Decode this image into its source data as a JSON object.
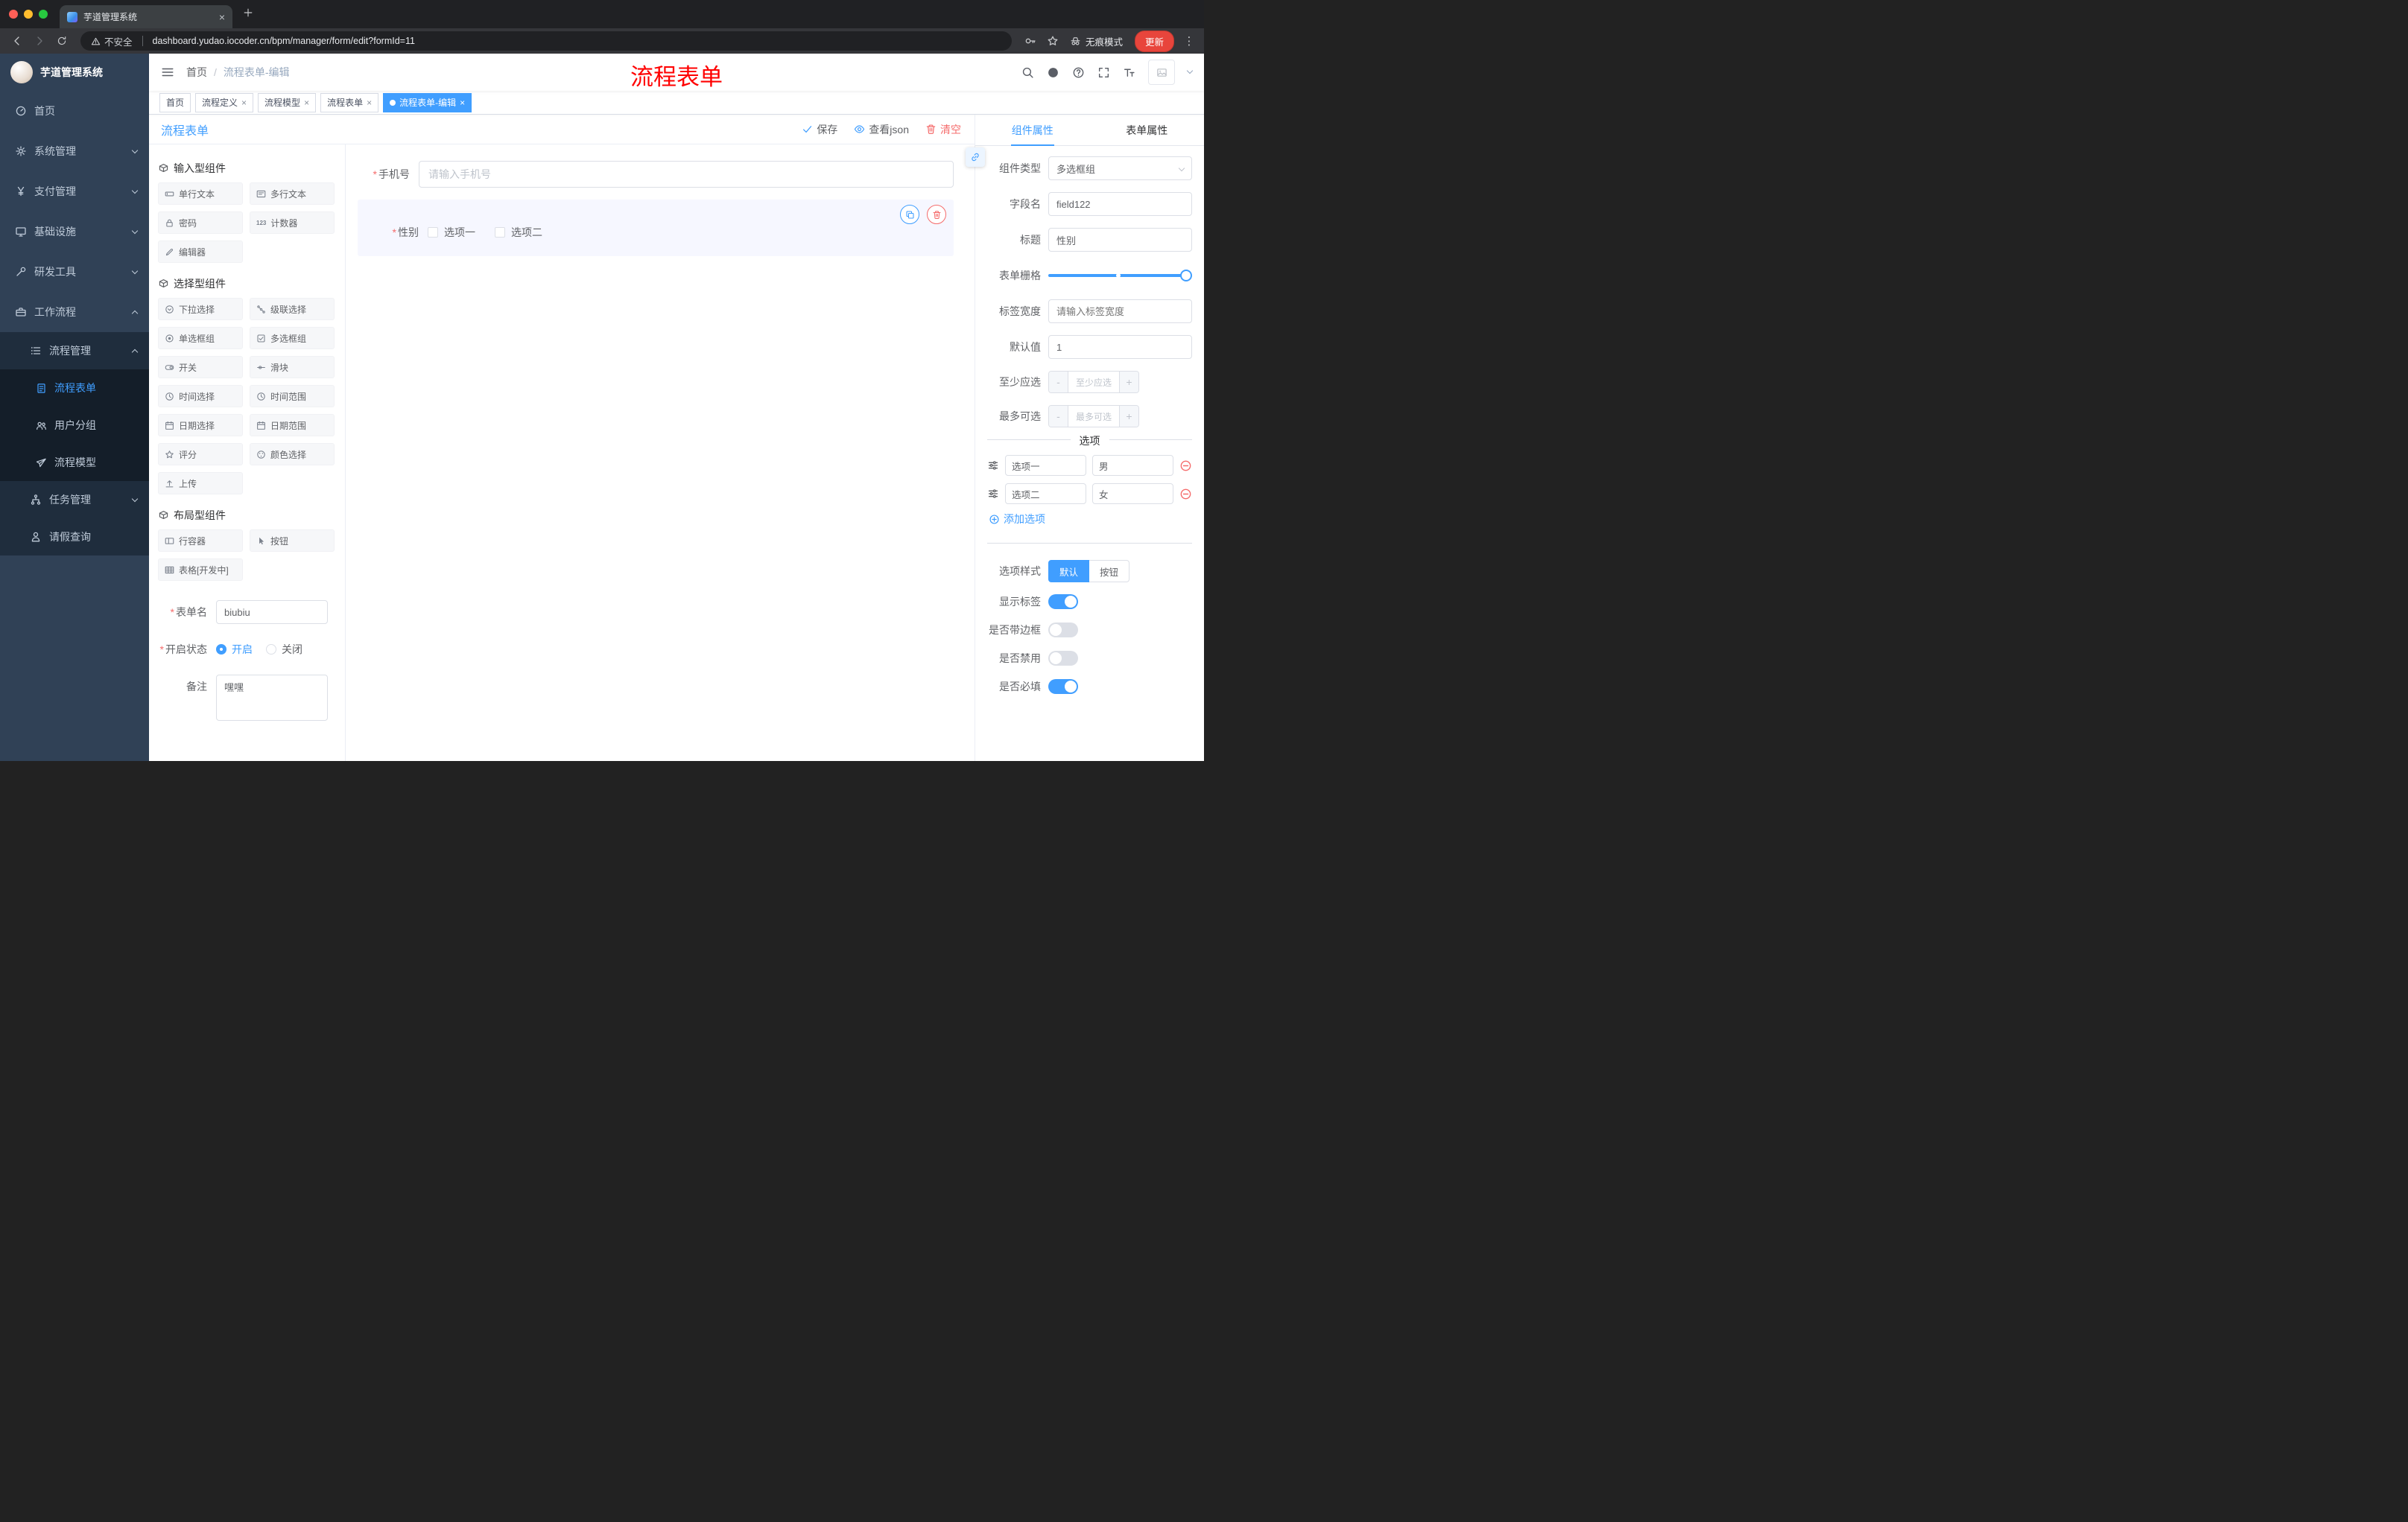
{
  "colors": {
    "accent": "#409eff",
    "danger": "#f56c6c",
    "annotation_red": "#ff0000",
    "sidebar_bg": "#304156",
    "sidebar_sub_bg": "#1f2d3d",
    "chrome_dark": "#202124",
    "update_button_bg": "#e8453c"
  },
  "misc": {
    "required": "*",
    "slash": "/",
    "close": "×",
    "minus": "-",
    "plus": "+",
    "menu_dots": "⋮"
  },
  "browser": {
    "tab_title": "芋道管理系统",
    "security_label": "不安全",
    "url": "dashboard.yudao.iocoder.cn/bpm/manager/form/edit?formId=11",
    "incognito_label": "无痕模式",
    "update_label": "更新"
  },
  "annotation": {
    "text": "流程表单"
  },
  "app_header": {
    "breadcrumb": {
      "home": "首页",
      "current": "流程表单-编辑"
    }
  },
  "sidebar": {
    "logo_title": "芋道管理系统",
    "menu": [
      {
        "label": "首页"
      },
      {
        "label": "系统管理"
      },
      {
        "label": "支付管理"
      },
      {
        "label": "基础设施"
      },
      {
        "label": "研发工具"
      },
      {
        "label": "工作流程"
      },
      {
        "label": "流程管理"
      },
      {
        "label": "流程表单"
      },
      {
        "label": "用户分组"
      },
      {
        "label": "流程模型"
      },
      {
        "label": "任务管理"
      },
      {
        "label": "请假查询"
      }
    ]
  },
  "tags": [
    {
      "label": "首页",
      "closable": false,
      "active": false
    },
    {
      "label": "流程定义",
      "closable": true,
      "active": false
    },
    {
      "label": "流程模型",
      "closable": true,
      "active": false
    },
    {
      "label": "流程表单",
      "closable": true,
      "active": false
    },
    {
      "label": "流程表单-编辑",
      "closable": true,
      "active": true
    }
  ],
  "board": {
    "title": "流程表单",
    "save": "保存",
    "view_json": "查看json",
    "clear": "清空"
  },
  "palette": {
    "sections": [
      {
        "title": "输入型组件",
        "items": [
          "单行文本",
          "多行文本",
          "密码",
          "计数器",
          "编辑器"
        ]
      },
      {
        "title": "选择型组件",
        "items": [
          "下拉选择",
          "级联选择",
          "单选框组",
          "多选框组",
          "开关",
          "滑块",
          "时间选择",
          "时间范围",
          "日期选择",
          "日期范围",
          "评分",
          "颜色选择",
          "上传"
        ]
      },
      {
        "title": "布局型组件",
        "items": [
          "行容器",
          "按钮",
          "表格[开发中]"
        ]
      }
    ]
  },
  "left_form": {
    "name_label": "表单名",
    "name_value": "biubiu",
    "status_label": "开启状态",
    "status_on": "开启",
    "status_off": "关闭",
    "status_selected": "开启",
    "remark_label": "备注",
    "remark_value": "嘿嘿"
  },
  "canvas": {
    "phone": {
      "label": "手机号",
      "placeholder": "请输入手机号",
      "required": true
    },
    "gender": {
      "label": "性别",
      "opt1": "选项一",
      "opt2": "选项二",
      "required": true
    }
  },
  "inspector": {
    "tab_component": "组件属性",
    "tab_form": "表单属性",
    "active_tab": "组件属性",
    "type_label": "组件类型",
    "type_value": "多选框组",
    "field_label": "字段名",
    "field_value": "field122",
    "title_label": "标题",
    "title_value": "性别",
    "grid_label": "表单栅格",
    "width_label": "标签宽度",
    "width_placeholder": "请输入标签宽度",
    "default_label": "默认值",
    "default_value": "1",
    "min_label": "至少应选",
    "min_placeholder": "至少应选",
    "max_label": "最多可选",
    "max_placeholder": "最多可选",
    "options_title": "选项",
    "options": [
      {
        "label": "选项一",
        "value": "男"
      },
      {
        "label": "选项二",
        "value": "女"
      }
    ],
    "add_option": "添加选项",
    "style_label": "选项样式",
    "style_default": "默认",
    "style_button": "按钮",
    "style_selected": "默认",
    "switch_show": "显示标签",
    "switch_show_on": true,
    "switch_border": "是否带边框",
    "switch_border_on": false,
    "switch_disabled": "是否禁用",
    "switch_disabled_on": false,
    "switch_required": "是否必填",
    "switch_required_on": true
  },
  "icons": {
    "search-icon": "magnifier",
    "github-icon": "filled circle",
    "help-icon": "question circle",
    "fullscreen-icon": "corner brackets",
    "font-size-icon": "T T",
    "hamburger-icon": "three lines",
    "save-check-icon": "check mark",
    "view-json-eye-icon": "eye",
    "clear-trash-icon": "trash can",
    "copy-icon": "two squares",
    "delete-icon": "trash can",
    "link-icon": "chain link",
    "drag-handle-icon": "slider lines",
    "remove-option-icon": "circled minus",
    "add-option-icon": "circled plus",
    "warning-icon": "triangle exclamation",
    "key-icon": "key",
    "bookmark-star-icon": "star",
    "incognito-icon": "hat and glasses"
  }
}
